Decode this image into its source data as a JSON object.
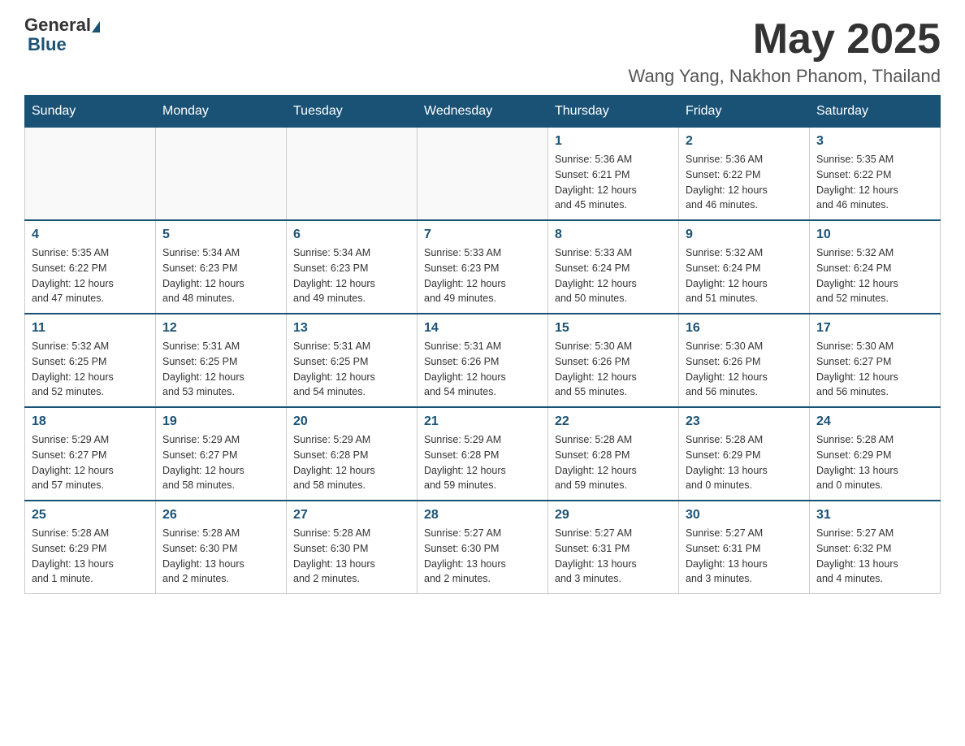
{
  "header": {
    "logo_general": "General",
    "logo_blue": "Blue",
    "month_title": "May 2025",
    "location": "Wang Yang, Nakhon Phanom, Thailand"
  },
  "days_of_week": [
    "Sunday",
    "Monday",
    "Tuesday",
    "Wednesday",
    "Thursday",
    "Friday",
    "Saturday"
  ],
  "weeks": [
    [
      {
        "day": "",
        "info": ""
      },
      {
        "day": "",
        "info": ""
      },
      {
        "day": "",
        "info": ""
      },
      {
        "day": "",
        "info": ""
      },
      {
        "day": "1",
        "info": "Sunrise: 5:36 AM\nSunset: 6:21 PM\nDaylight: 12 hours\nand 45 minutes."
      },
      {
        "day": "2",
        "info": "Sunrise: 5:36 AM\nSunset: 6:22 PM\nDaylight: 12 hours\nand 46 minutes."
      },
      {
        "day": "3",
        "info": "Sunrise: 5:35 AM\nSunset: 6:22 PM\nDaylight: 12 hours\nand 46 minutes."
      }
    ],
    [
      {
        "day": "4",
        "info": "Sunrise: 5:35 AM\nSunset: 6:22 PM\nDaylight: 12 hours\nand 47 minutes."
      },
      {
        "day": "5",
        "info": "Sunrise: 5:34 AM\nSunset: 6:23 PM\nDaylight: 12 hours\nand 48 minutes."
      },
      {
        "day": "6",
        "info": "Sunrise: 5:34 AM\nSunset: 6:23 PM\nDaylight: 12 hours\nand 49 minutes."
      },
      {
        "day": "7",
        "info": "Sunrise: 5:33 AM\nSunset: 6:23 PM\nDaylight: 12 hours\nand 49 minutes."
      },
      {
        "day": "8",
        "info": "Sunrise: 5:33 AM\nSunset: 6:24 PM\nDaylight: 12 hours\nand 50 minutes."
      },
      {
        "day": "9",
        "info": "Sunrise: 5:32 AM\nSunset: 6:24 PM\nDaylight: 12 hours\nand 51 minutes."
      },
      {
        "day": "10",
        "info": "Sunrise: 5:32 AM\nSunset: 6:24 PM\nDaylight: 12 hours\nand 52 minutes."
      }
    ],
    [
      {
        "day": "11",
        "info": "Sunrise: 5:32 AM\nSunset: 6:25 PM\nDaylight: 12 hours\nand 52 minutes."
      },
      {
        "day": "12",
        "info": "Sunrise: 5:31 AM\nSunset: 6:25 PM\nDaylight: 12 hours\nand 53 minutes."
      },
      {
        "day": "13",
        "info": "Sunrise: 5:31 AM\nSunset: 6:25 PM\nDaylight: 12 hours\nand 54 minutes."
      },
      {
        "day": "14",
        "info": "Sunrise: 5:31 AM\nSunset: 6:26 PM\nDaylight: 12 hours\nand 54 minutes."
      },
      {
        "day": "15",
        "info": "Sunrise: 5:30 AM\nSunset: 6:26 PM\nDaylight: 12 hours\nand 55 minutes."
      },
      {
        "day": "16",
        "info": "Sunrise: 5:30 AM\nSunset: 6:26 PM\nDaylight: 12 hours\nand 56 minutes."
      },
      {
        "day": "17",
        "info": "Sunrise: 5:30 AM\nSunset: 6:27 PM\nDaylight: 12 hours\nand 56 minutes."
      }
    ],
    [
      {
        "day": "18",
        "info": "Sunrise: 5:29 AM\nSunset: 6:27 PM\nDaylight: 12 hours\nand 57 minutes."
      },
      {
        "day": "19",
        "info": "Sunrise: 5:29 AM\nSunset: 6:27 PM\nDaylight: 12 hours\nand 58 minutes."
      },
      {
        "day": "20",
        "info": "Sunrise: 5:29 AM\nSunset: 6:28 PM\nDaylight: 12 hours\nand 58 minutes."
      },
      {
        "day": "21",
        "info": "Sunrise: 5:29 AM\nSunset: 6:28 PM\nDaylight: 12 hours\nand 59 minutes."
      },
      {
        "day": "22",
        "info": "Sunrise: 5:28 AM\nSunset: 6:28 PM\nDaylight: 12 hours\nand 59 minutes."
      },
      {
        "day": "23",
        "info": "Sunrise: 5:28 AM\nSunset: 6:29 PM\nDaylight: 13 hours\nand 0 minutes."
      },
      {
        "day": "24",
        "info": "Sunrise: 5:28 AM\nSunset: 6:29 PM\nDaylight: 13 hours\nand 0 minutes."
      }
    ],
    [
      {
        "day": "25",
        "info": "Sunrise: 5:28 AM\nSunset: 6:29 PM\nDaylight: 13 hours\nand 1 minute."
      },
      {
        "day": "26",
        "info": "Sunrise: 5:28 AM\nSunset: 6:30 PM\nDaylight: 13 hours\nand 2 minutes."
      },
      {
        "day": "27",
        "info": "Sunrise: 5:28 AM\nSunset: 6:30 PM\nDaylight: 13 hours\nand 2 minutes."
      },
      {
        "day": "28",
        "info": "Sunrise: 5:27 AM\nSunset: 6:30 PM\nDaylight: 13 hours\nand 2 minutes."
      },
      {
        "day": "29",
        "info": "Sunrise: 5:27 AM\nSunset: 6:31 PM\nDaylight: 13 hours\nand 3 minutes."
      },
      {
        "day": "30",
        "info": "Sunrise: 5:27 AM\nSunset: 6:31 PM\nDaylight: 13 hours\nand 3 minutes."
      },
      {
        "day": "31",
        "info": "Sunrise: 5:27 AM\nSunset: 6:32 PM\nDaylight: 13 hours\nand 4 minutes."
      }
    ]
  ]
}
